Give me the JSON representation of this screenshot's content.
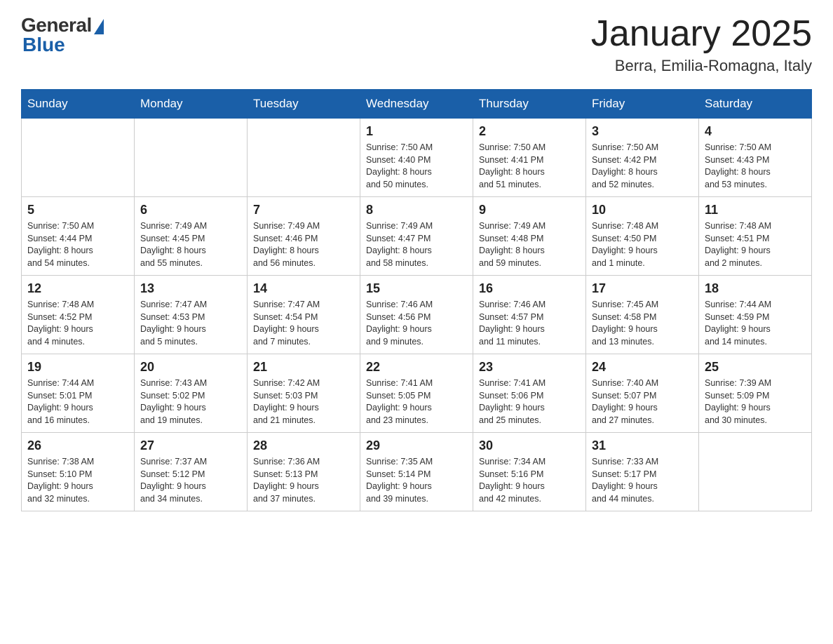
{
  "header": {
    "logo_general": "General",
    "logo_blue": "Blue",
    "month_title": "January 2025",
    "location": "Berra, Emilia-Romagna, Italy"
  },
  "days_of_week": [
    "Sunday",
    "Monday",
    "Tuesday",
    "Wednesday",
    "Thursday",
    "Friday",
    "Saturday"
  ],
  "weeks": [
    [
      {
        "day": "",
        "info": ""
      },
      {
        "day": "",
        "info": ""
      },
      {
        "day": "",
        "info": ""
      },
      {
        "day": "1",
        "info": "Sunrise: 7:50 AM\nSunset: 4:40 PM\nDaylight: 8 hours\nand 50 minutes."
      },
      {
        "day": "2",
        "info": "Sunrise: 7:50 AM\nSunset: 4:41 PM\nDaylight: 8 hours\nand 51 minutes."
      },
      {
        "day": "3",
        "info": "Sunrise: 7:50 AM\nSunset: 4:42 PM\nDaylight: 8 hours\nand 52 minutes."
      },
      {
        "day": "4",
        "info": "Sunrise: 7:50 AM\nSunset: 4:43 PM\nDaylight: 8 hours\nand 53 minutes."
      }
    ],
    [
      {
        "day": "5",
        "info": "Sunrise: 7:50 AM\nSunset: 4:44 PM\nDaylight: 8 hours\nand 54 minutes."
      },
      {
        "day": "6",
        "info": "Sunrise: 7:49 AM\nSunset: 4:45 PM\nDaylight: 8 hours\nand 55 minutes."
      },
      {
        "day": "7",
        "info": "Sunrise: 7:49 AM\nSunset: 4:46 PM\nDaylight: 8 hours\nand 56 minutes."
      },
      {
        "day": "8",
        "info": "Sunrise: 7:49 AM\nSunset: 4:47 PM\nDaylight: 8 hours\nand 58 minutes."
      },
      {
        "day": "9",
        "info": "Sunrise: 7:49 AM\nSunset: 4:48 PM\nDaylight: 8 hours\nand 59 minutes."
      },
      {
        "day": "10",
        "info": "Sunrise: 7:48 AM\nSunset: 4:50 PM\nDaylight: 9 hours\nand 1 minute."
      },
      {
        "day": "11",
        "info": "Sunrise: 7:48 AM\nSunset: 4:51 PM\nDaylight: 9 hours\nand 2 minutes."
      }
    ],
    [
      {
        "day": "12",
        "info": "Sunrise: 7:48 AM\nSunset: 4:52 PM\nDaylight: 9 hours\nand 4 minutes."
      },
      {
        "day": "13",
        "info": "Sunrise: 7:47 AM\nSunset: 4:53 PM\nDaylight: 9 hours\nand 5 minutes."
      },
      {
        "day": "14",
        "info": "Sunrise: 7:47 AM\nSunset: 4:54 PM\nDaylight: 9 hours\nand 7 minutes."
      },
      {
        "day": "15",
        "info": "Sunrise: 7:46 AM\nSunset: 4:56 PM\nDaylight: 9 hours\nand 9 minutes."
      },
      {
        "day": "16",
        "info": "Sunrise: 7:46 AM\nSunset: 4:57 PM\nDaylight: 9 hours\nand 11 minutes."
      },
      {
        "day": "17",
        "info": "Sunrise: 7:45 AM\nSunset: 4:58 PM\nDaylight: 9 hours\nand 13 minutes."
      },
      {
        "day": "18",
        "info": "Sunrise: 7:44 AM\nSunset: 4:59 PM\nDaylight: 9 hours\nand 14 minutes."
      }
    ],
    [
      {
        "day": "19",
        "info": "Sunrise: 7:44 AM\nSunset: 5:01 PM\nDaylight: 9 hours\nand 16 minutes."
      },
      {
        "day": "20",
        "info": "Sunrise: 7:43 AM\nSunset: 5:02 PM\nDaylight: 9 hours\nand 19 minutes."
      },
      {
        "day": "21",
        "info": "Sunrise: 7:42 AM\nSunset: 5:03 PM\nDaylight: 9 hours\nand 21 minutes."
      },
      {
        "day": "22",
        "info": "Sunrise: 7:41 AM\nSunset: 5:05 PM\nDaylight: 9 hours\nand 23 minutes."
      },
      {
        "day": "23",
        "info": "Sunrise: 7:41 AM\nSunset: 5:06 PM\nDaylight: 9 hours\nand 25 minutes."
      },
      {
        "day": "24",
        "info": "Sunrise: 7:40 AM\nSunset: 5:07 PM\nDaylight: 9 hours\nand 27 minutes."
      },
      {
        "day": "25",
        "info": "Sunrise: 7:39 AM\nSunset: 5:09 PM\nDaylight: 9 hours\nand 30 minutes."
      }
    ],
    [
      {
        "day": "26",
        "info": "Sunrise: 7:38 AM\nSunset: 5:10 PM\nDaylight: 9 hours\nand 32 minutes."
      },
      {
        "day": "27",
        "info": "Sunrise: 7:37 AM\nSunset: 5:12 PM\nDaylight: 9 hours\nand 34 minutes."
      },
      {
        "day": "28",
        "info": "Sunrise: 7:36 AM\nSunset: 5:13 PM\nDaylight: 9 hours\nand 37 minutes."
      },
      {
        "day": "29",
        "info": "Sunrise: 7:35 AM\nSunset: 5:14 PM\nDaylight: 9 hours\nand 39 minutes."
      },
      {
        "day": "30",
        "info": "Sunrise: 7:34 AM\nSunset: 5:16 PM\nDaylight: 9 hours\nand 42 minutes."
      },
      {
        "day": "31",
        "info": "Sunrise: 7:33 AM\nSunset: 5:17 PM\nDaylight: 9 hours\nand 44 minutes."
      },
      {
        "day": "",
        "info": ""
      }
    ]
  ]
}
